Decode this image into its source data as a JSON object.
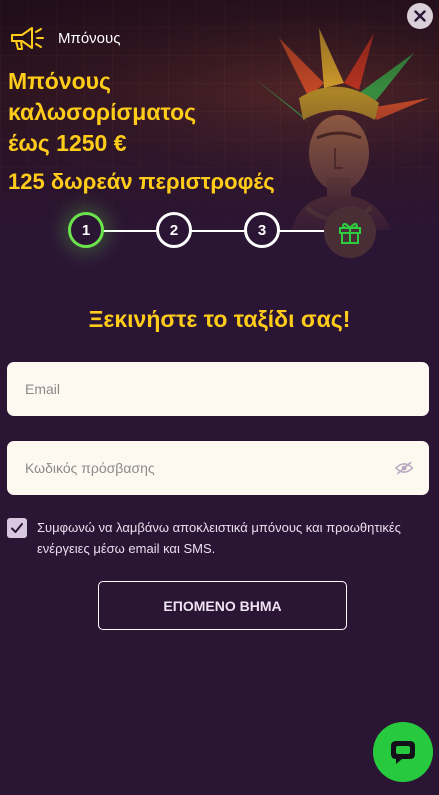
{
  "header": {
    "title": "Μπόνους",
    "close_icon": "close-icon",
    "megaphone_icon": "megaphone-icon"
  },
  "offer": {
    "line1": "Μπόνους",
    "line2": "καλωσορίσματος",
    "line3": "έως 1250 €",
    "spins": "125 δωρεάν περιστροφές"
  },
  "stepper": {
    "steps": [
      "1",
      "2",
      "3"
    ],
    "active_step": 1,
    "final_icon": "gift-icon"
  },
  "form": {
    "heading": "Ξεκινήστε το ταξίδι σας!",
    "email_placeholder": "Email",
    "password_placeholder": "Κωδικός πρόσβασης",
    "consent_text": "Συμφωνώ να λαμβάνω αποκλειστικά μπόνους και προωθητικές ενέργειες μέσω email και SMS.",
    "consent_checked": true,
    "next_button": "ΕΠΟΜΕΝΟ ΒΗΜΑ"
  },
  "chat": {
    "icon": "chat-icon"
  },
  "colors": {
    "background": "#2b1535",
    "accent_yellow": "#ffcc1a",
    "active_green": "#6be34c",
    "chat_green": "#27c93f",
    "field_bg": "#fdf8f0"
  }
}
